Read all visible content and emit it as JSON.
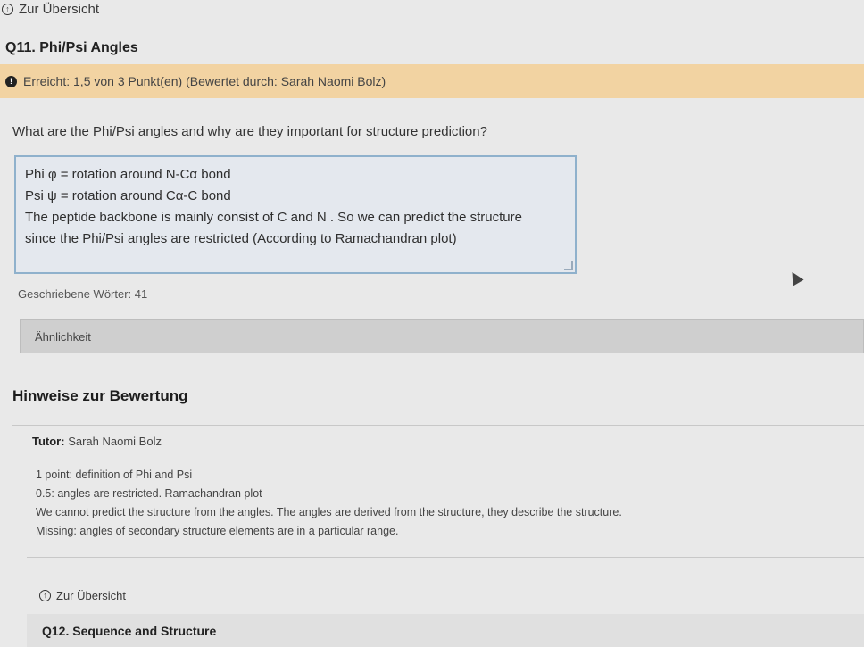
{
  "nav": {
    "back_top": "Zur Übersicht",
    "back_bottom": "Zur Übersicht"
  },
  "question": {
    "title": "Q11. Phi/Psi Angles",
    "status": "Erreicht: 1,5 von 3 Punkt(en) (Bewertet durch: Sarah Naomi Bolz)",
    "text": "What are the Phi/Psi angles and why are they important for structure prediction?",
    "answer_lines": [
      "Phi φ = rotation around N-Cα bond",
      "Psi ψ = rotation around Cα-C bond",
      "The peptide backbone is mainly consist of C and N . So we can predict the structure",
      "since the Phi/Psi angles are restricted (According to Ramachandran plot)"
    ],
    "word_count": "Geschriebene Wörter: 41",
    "similarity_label": "Ähnlichkeit"
  },
  "feedback": {
    "heading": "Hinweise zur Bewertung",
    "tutor_label": "Tutor:",
    "tutor_name": "Sarah Naomi Bolz",
    "notes": [
      "1 point: definition of Phi and Psi",
      "0.5: angles are restricted. Ramachandran plot",
      "We cannot predict the structure from the angles. The angles are derived from the structure, they describe the structure.",
      "Missing: angles of secondary structure elements are in a particular range."
    ]
  },
  "next_question": {
    "title": "Q12. Sequence and Structure"
  },
  "colors": {
    "banner": "#f2d3a2",
    "answer_border": "#8fb1cc"
  }
}
